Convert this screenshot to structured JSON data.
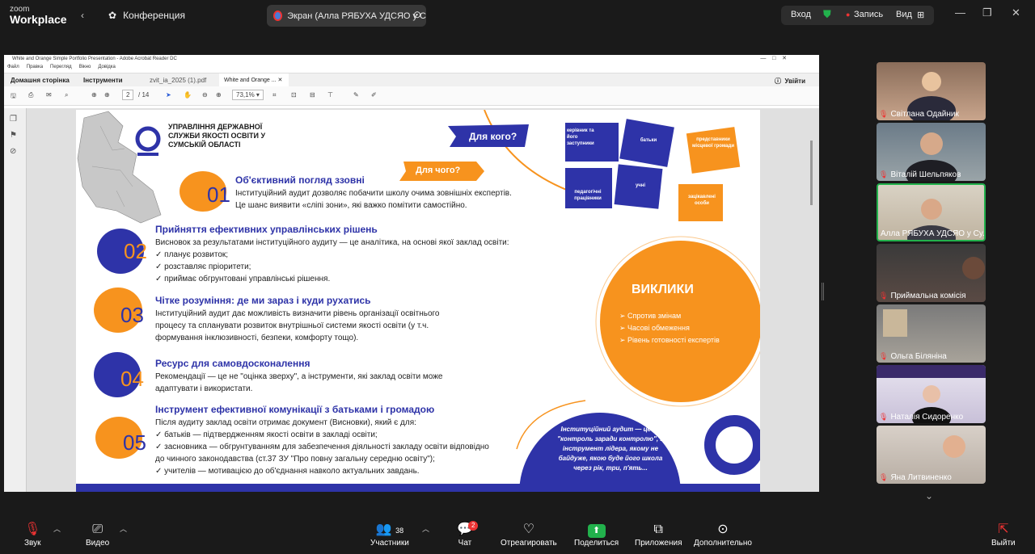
{
  "app": {
    "brand_top": "zoom",
    "brand_bottom": "Workplace",
    "conference_label": "Конференция",
    "screen_tab": "Экран (Алла РЯБУХА УДСЯО у С"
  },
  "topright": {
    "login": "Вход",
    "record": "Запись",
    "view": "Вид"
  },
  "acrobat": {
    "title": "White and Orange Simple Portfolio Presentation - Adobe Acrobat Reader DC",
    "menu": [
      "Файл",
      "Правка",
      "Перегляд",
      "Вікно",
      "Довідка"
    ],
    "tabs": {
      "home": "Домашня сторінка",
      "tools": "Інструменти",
      "doc1": "zvit_ia_2025 (1).pdf",
      "doc2": "White and Orange ...",
      "signin": "Увійти"
    },
    "page_current": "2",
    "page_total": "/ 14",
    "zoom": "73,1%"
  },
  "slide": {
    "org": "УПРАВЛІННЯ ДЕРЖАВНОЇ СЛУЖБИ ЯКОСТІ ОСВІТИ У СУМСЬКІЙ ОБЛАСТІ",
    "tag_who": "Для кого?",
    "tag_why": "Для чого?",
    "puzzle": [
      "керівник та його заступники",
      "батьки",
      "представники місцевої громади",
      "педагогічні працівники",
      "учні",
      "зацікавлені особи"
    ],
    "sections": [
      {
        "num": "01",
        "title": "Об'єктивний погляд ззовні",
        "lines": [
          "Інституційний аудит дозволяє побачити школу очима зовнішніх експертів.",
          "Це шанс виявити «сліпі зони», які важко помітити самостійно."
        ]
      },
      {
        "num": "02",
        "title": "Прийняття ефективних управлінських рішень",
        "lines": [
          "Висновок за результатами інституційного аудиту — це аналітика, на основі якої заклад освіти:",
          "✓ планує розвиток;",
          "✓ розставляє пріоритети;",
          "✓ приймає обгрунтовані управлінські рішення."
        ]
      },
      {
        "num": "03",
        "title": "Чітке розуміння: де ми зараз і куди рухатись",
        "lines": [
          "Інституційний аудит дає можливість визначити рівень організації освітнього",
          "процесу та спланувати розвиток внутрішньої системи якості освіти (у т.ч.",
          "формування інклюзивності, безпеки, комфорту тощо)."
        ]
      },
      {
        "num": "04",
        "title": "Ресурс для самовдосконалення",
        "lines": [
          "Рекомендації — це не \"оцінка зверху\", а інструменти, які заклад освіти може",
          "адаптувати і використати."
        ]
      },
      {
        "num": "05",
        "title": "Інструмент ефективної комунікації з батьками і громадою",
        "lines": [
          "Після аудиту заклад освіти отримає документ (Висновки), який є для:",
          "✓ батьків — підтвердженням якості освіти в закладі освіти;",
          "✓ засновника — обгрунтуванням для забезпечення діяльності закладу освіти відповідно",
          "   до чинного законодавства (ст.37 ЗУ \"Про повну загальну середню освіту\");",
          "✓ учителів — мотивацією до об'єднання навколо актуальних завдань."
        ]
      }
    ],
    "challenges_title": "ВИКЛИКИ",
    "challenges": [
      "Спротив змінам",
      "Часові обмеження",
      "Рівень готовності експертів"
    ],
    "quote": "Інституційний аудит — це не \"контроль заради контролю\", а інструмент лідера, якому не байдуже, якою буде його школа через рік, три, п'ять..."
  },
  "participants": [
    "Світлана Одайник",
    "Віталій Шельпяков",
    "Алла РЯБУХА УДСЯО у Су...",
    "Приймальна комісія",
    "Ольга Біляніна",
    "Наталія Сидоренко",
    "Яна Литвиненко"
  ],
  "toolbar": {
    "mute": "Звук",
    "video": "Видео",
    "participants": "Участники",
    "participants_count": "38",
    "chat": "Чат",
    "chat_badge": "2",
    "react": "Отреагировать",
    "share": "Поделиться",
    "apps": "Приложения",
    "more": "Дополнительно",
    "leave": "Выйти"
  },
  "colors": {
    "accent_blue": "#2e33a8",
    "orange": "#f7931e",
    "share_green": "#22b14c"
  }
}
